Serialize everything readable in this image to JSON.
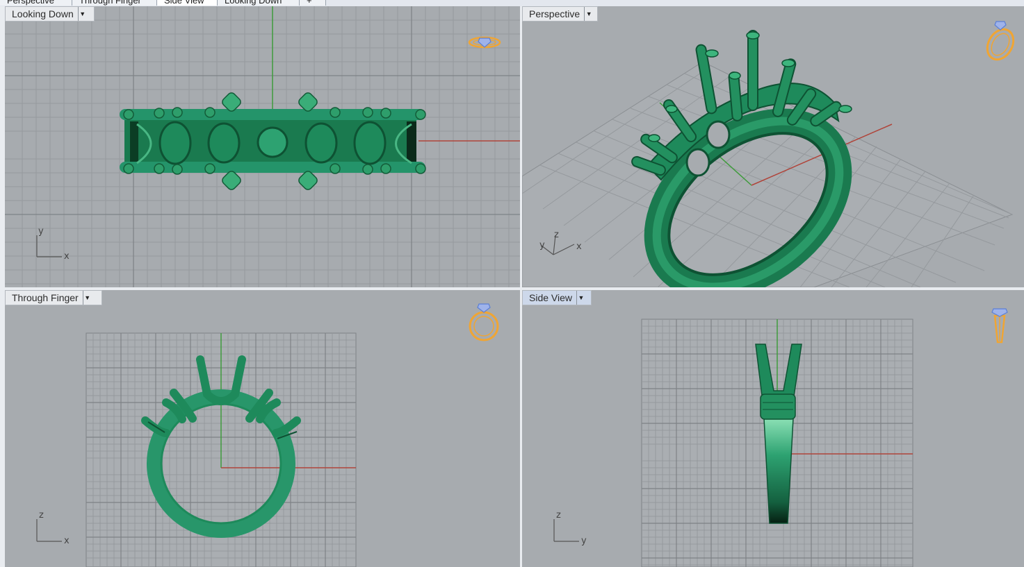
{
  "tabs": [
    {
      "label": "Perspective",
      "active": false
    },
    {
      "label": "Through Finger",
      "active": false
    },
    {
      "label": "Side View",
      "active": true
    },
    {
      "label": "Looking Down",
      "active": false
    },
    {
      "label": "+",
      "active": false
    }
  ],
  "viewports": {
    "top_left": {
      "title": "Looking Down",
      "axis_h": "x",
      "axis_v": "y",
      "active": false
    },
    "top_right": {
      "title": "Perspective",
      "axis_a": "y",
      "axis_b": "z",
      "axis_c": "x",
      "active": false
    },
    "bottom_left": {
      "title": "Through Finger",
      "axis_h": "x",
      "axis_v": "z",
      "active": false
    },
    "bottom_right": {
      "title": "Side View",
      "axis_h": "y",
      "axis_v": "z",
      "active": true
    }
  },
  "icons": {
    "dropdown": "caret-down-icon",
    "ring_preview": "ring-preview-icon"
  },
  "colors": {
    "viewport_bg": "#a7abaf",
    "grid_line": "#8e9296",
    "grid_major": "#7d8185",
    "model_green": "#1e8a5b",
    "x_axis": "#b0443a",
    "y_axis": "#3f9b3c",
    "ring_icon": "#f0a533",
    "gem_icon": "#5b7fd6"
  }
}
